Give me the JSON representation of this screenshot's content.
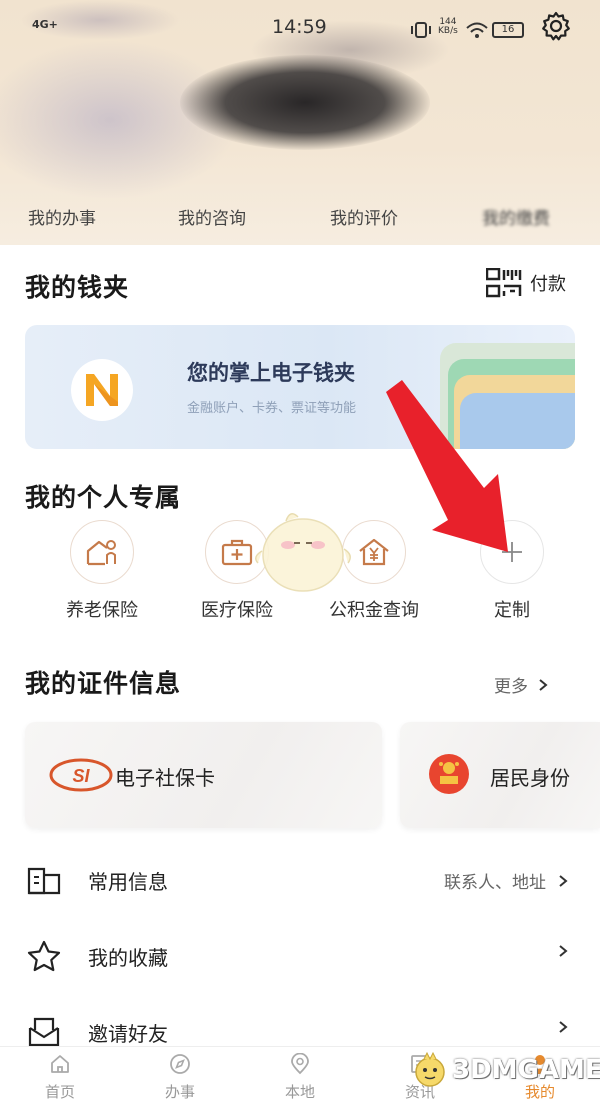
{
  "status_bar": {
    "network": "4G+",
    "time": "14:59",
    "speed_value": "144",
    "speed_unit": "KB/s",
    "battery": "16"
  },
  "header_tabs": [
    "我的办事",
    "我的咨询",
    "我的评价",
    "我的缴费"
  ],
  "wallet": {
    "title": "我的钱夹",
    "pay_label": "付款",
    "card_title": "您的掌上电子钱夹",
    "card_subtitle": "金融账户、卡券、票证等功能"
  },
  "personal": {
    "title": "我的个人专属",
    "items": [
      {
        "label": "养老保险",
        "icon": "elderly-icon"
      },
      {
        "label": "医疗保险",
        "icon": "medical-kit-icon"
      },
      {
        "label": "公积金查询",
        "icon": "house-yuan-icon"
      },
      {
        "label": "定制",
        "icon": "plus-icon"
      }
    ]
  },
  "certificates": {
    "title": "我的证件信息",
    "more_label": "更多",
    "cards": [
      {
        "label": "电子社保卡",
        "icon": "social-security-logo"
      },
      {
        "label": "居民身份",
        "icon": "national-emblem-icon"
      }
    ]
  },
  "list": [
    {
      "label": "常用信息",
      "right": "联系人、地址",
      "icon": "info-card-icon"
    },
    {
      "label": "我的收藏",
      "right": "",
      "icon": "star-icon"
    },
    {
      "label": "邀请好友",
      "right": "",
      "icon": "invite-icon"
    }
  ],
  "tabbar": [
    {
      "label": "首页",
      "icon": "home-icon"
    },
    {
      "label": "办事",
      "icon": "compass-icon"
    },
    {
      "label": "本地",
      "icon": "location-icon"
    },
    {
      "label": "资讯",
      "icon": "news-icon"
    },
    {
      "label": "我的",
      "icon": "user-icon"
    }
  ],
  "watermark": "3DMGAME",
  "colors": {
    "header_bg": "#f1e3cf",
    "accent_orange": "#f5a623",
    "arrow_red": "#e8212b",
    "wallet_card_bg": "#e6eef8"
  }
}
